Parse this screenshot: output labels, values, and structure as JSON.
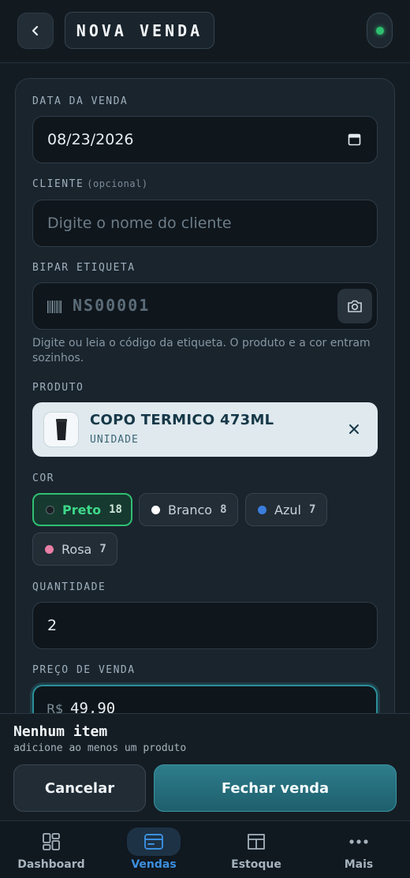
{
  "header": {
    "title": "NOVA VENDA",
    "back_icon": "chevron-left-icon",
    "status_color": "#2fbf71"
  },
  "form": {
    "date": {
      "label": "DATA DA VENDA",
      "value": "08/23/2026"
    },
    "client": {
      "label": "CLIENTE",
      "optional": "(opcional)",
      "placeholder": "Digite o nome do cliente"
    },
    "scan": {
      "label": "BIPAR ETIQUETA",
      "placeholder": "NS00001",
      "hint": "Digite ou leia o código da etiqueta. O produto e a cor entram sozinhos."
    },
    "product": {
      "label": "PRODUTO",
      "name": "COPO TERMICO 473ML",
      "unit": "UNIDADE"
    },
    "color": {
      "label": "COR",
      "options": [
        {
          "name": "Preto",
          "count": "18",
          "color": "#1b1f23",
          "selected": true
        },
        {
          "name": "Branco",
          "count": "8",
          "color": "#ffffff",
          "selected": false
        },
        {
          "name": "Azul",
          "count": "7",
          "color": "#3b7ddd",
          "selected": false
        },
        {
          "name": "Rosa",
          "count": "7",
          "color": "#e87fa5",
          "selected": false
        }
      ]
    },
    "quantity": {
      "label": "QUANTIDADE",
      "value": "2"
    },
    "price": {
      "label": "PREÇO DE VENDA",
      "prefix": "R$",
      "value": "49,90"
    }
  },
  "summary": {
    "title": "Nenhum item",
    "subtitle": "adicione ao menos um produto",
    "cancel_label": "Cancelar",
    "close_label": "Fechar venda"
  },
  "nav": {
    "items": [
      {
        "label": "Dashboard",
        "icon": "dashboard-icon",
        "active": false
      },
      {
        "label": "Vendas",
        "icon": "card-icon",
        "active": true
      },
      {
        "label": "Estoque",
        "icon": "box-icon",
        "active": false
      },
      {
        "label": "Mais",
        "icon": "more-icon",
        "active": false
      }
    ]
  },
  "colors": {
    "accent_green": "#2fbf71",
    "accent_teal": "#2b8f9a",
    "accent_blue": "#3c8fe0",
    "background": "#141c23"
  }
}
